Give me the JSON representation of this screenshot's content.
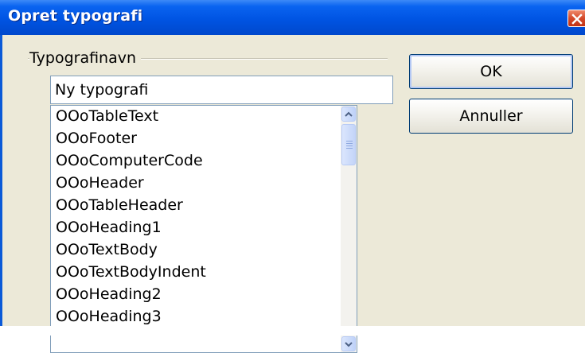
{
  "window": {
    "title": "Opret typografi",
    "close_icon": "close-icon"
  },
  "group": {
    "label": "Typografinavn"
  },
  "name_input": {
    "value": "Ny typografi"
  },
  "styles_list": {
    "items": [
      "OOoTableText",
      "OOoFooter",
      "OOoComputerCode",
      "OOoHeader",
      "OOoTableHeader",
      "OOoHeading1",
      "OOoTextBody",
      "OOoTextBodyIndent",
      "OOoHeading2",
      "OOoHeading3"
    ]
  },
  "buttons": {
    "ok_label": "OK",
    "cancel_label": "Annuller"
  },
  "colors": {
    "titlebar": "#0054e3",
    "dialog_face": "#ece9d8",
    "close_button": "#d4492a"
  }
}
